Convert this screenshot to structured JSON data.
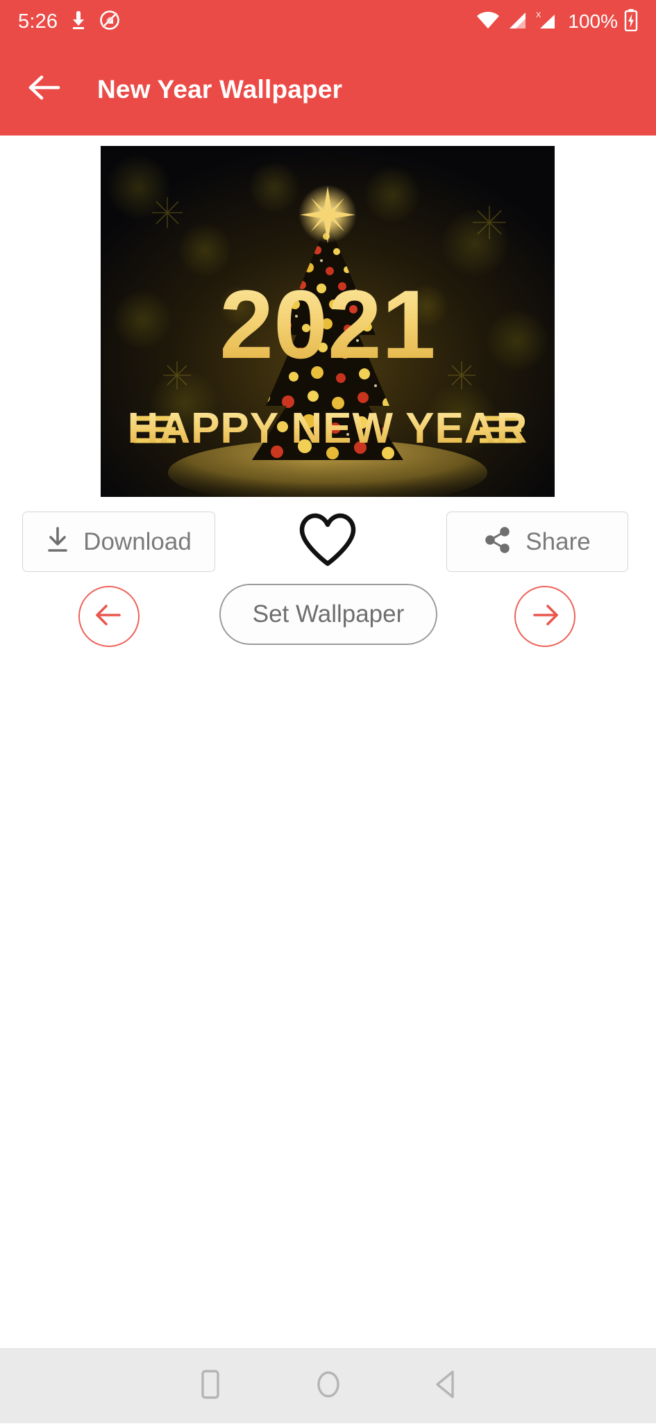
{
  "status_bar": {
    "clock": "5:26",
    "battery_percent": "100%",
    "icons": {
      "download": "download-indicator-icon",
      "do_not_disturb": "do-not-disturb-icon",
      "wifi": "wifi-icon",
      "signal_1": "cellular-signal-icon",
      "signal_2": "cellular-signal-no-sim-icon",
      "signal_2_badge": "X",
      "battery": "battery-charging-icon"
    },
    "background_color": "#eb4b47",
    "foreground_color": "#ffffff"
  },
  "app_bar": {
    "title": "New Year Wallpaper",
    "back_icon": "arrow-left-icon",
    "background_color": "#eb4b47",
    "title_color": "#ffffff"
  },
  "preview": {
    "alt": "2021 Happy New Year Christmas tree wallpaper",
    "overlay_year": "2021",
    "overlay_greeting": "HAPPY NEW YEAR",
    "gold_color": "#f2d06b",
    "background_color": "#0a0b04"
  },
  "actions": {
    "download_label": "Download",
    "download_icon": "download-icon",
    "favorite_icon": "heart-outline-icon",
    "favorite_state": "off",
    "share_label": "Share",
    "share_icon": "share-icon",
    "label_color": "#7a7a7a",
    "border_color": "#d6d6d6"
  },
  "navigation": {
    "prev_icon": "arrow-left-circle-icon",
    "next_icon": "arrow-right-circle-icon",
    "set_wallpaper_label": "Set Wallpaper",
    "accent_color": "#ee6159",
    "set_wallpaper_border_color": "#9b9b9b",
    "set_wallpaper_label_color": "#6e6e6e"
  },
  "system_nav": {
    "recents_icon": "square-recents-icon",
    "home_icon": "circle-home-icon",
    "back_icon": "triangle-back-icon",
    "background_color": "#eaeaea",
    "icon_color": "#b4b4b4"
  }
}
